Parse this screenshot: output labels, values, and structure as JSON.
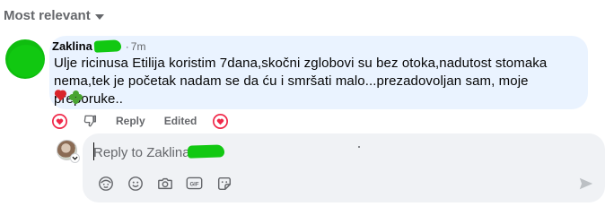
{
  "sort": {
    "label": "Most relevant",
    "icon": "caret-down-icon"
  },
  "comment": {
    "author": "Zaklina",
    "separator": "·",
    "time": "7m",
    "text": "Ulje ricinusa Etilija koristim 7dana,skočni zglobovi su bez otoka,nadutost stomaka nema,tek je početak nadam se da ću i smršati malo...prezadovoljan sam, moje preporuke..",
    "emojis": [
      "heart",
      "four-leaf-clover"
    ]
  },
  "actions": {
    "reply_label": "Reply",
    "edited_label": "Edited"
  },
  "reply_box": {
    "placeholder": "Reply to Zaklina",
    "tools": [
      "avatar-sticker-icon",
      "emoji-icon",
      "camera-icon",
      "gif-icon",
      "sticker-icon"
    ],
    "send_icon": "send-icon"
  },
  "colors": {
    "bubble": "#eaf3ff",
    "reply_box": "#f0f2f5",
    "redaction_green": "#12c812",
    "secondary_text": "#65676b",
    "like_red": "#f02849"
  }
}
